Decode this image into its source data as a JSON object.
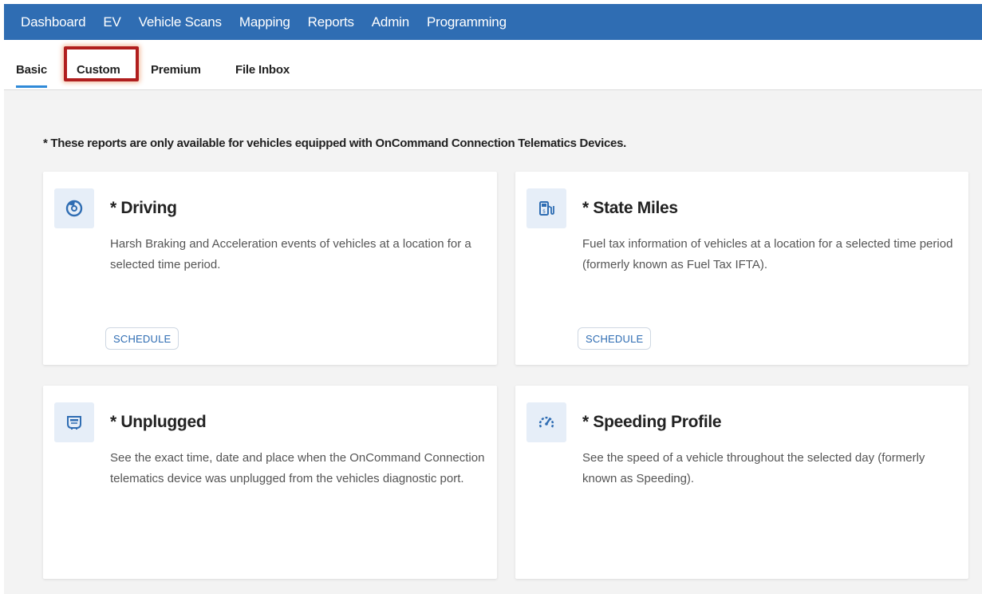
{
  "topnav": {
    "items": [
      "Dashboard",
      "EV",
      "Vehicle Scans",
      "Mapping",
      "Reports",
      "Admin",
      "Programming"
    ]
  },
  "subnav": {
    "tabs": [
      "Basic",
      "Custom",
      "Premium",
      "File Inbox"
    ],
    "active": "Basic"
  },
  "notice": "* These reports are only available for vehicles equipped with OnCommand Connection Telematics Devices.",
  "cards": [
    {
      "icon": "driving-icon",
      "title": "* Driving",
      "description": "Harsh Braking and Acceleration events of vehicles at a location for a selected time period.",
      "button": "SCHEDULE"
    },
    {
      "icon": "fuel-pump-icon",
      "title": "* State Miles",
      "description": "Fuel tax information of vehicles at a location for a selected time period (formerly known as Fuel Tax IFTA).",
      "button": "SCHEDULE"
    },
    {
      "icon": "device-plug-icon",
      "title": "* Unplugged",
      "description": "See the exact time, date and place when the OnCommand Connection telematics device was unplugged from the vehicles diagnostic port."
    },
    {
      "icon": "speedometer-icon",
      "title": "* Speeding Profile",
      "description": "See the speed of a vehicle throughout the selected day (formerly known as Speeding)."
    }
  ],
  "colors": {
    "nav_bg": "#2f6db3",
    "tab_underline": "#2f8ad8",
    "highlight_border": "#b01e1e",
    "icon_color": "#2f6db3"
  }
}
